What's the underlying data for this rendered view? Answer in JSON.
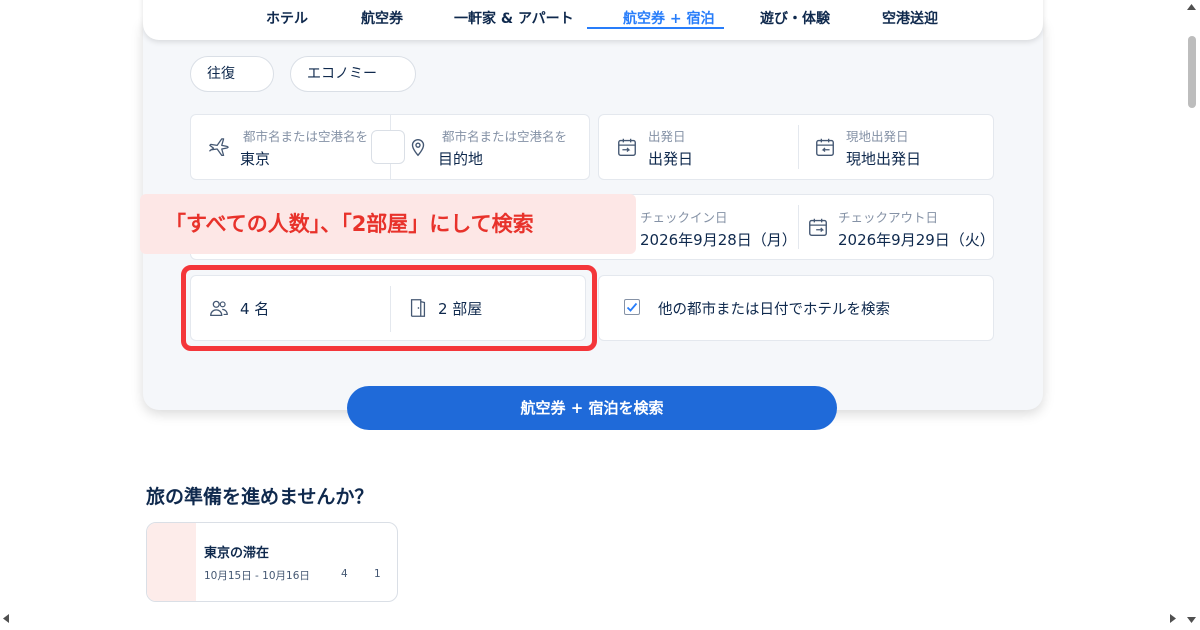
{
  "tabs": [
    {
      "label": "ホテル"
    },
    {
      "label": "航空券"
    },
    {
      "label": "一軒家 & アパート"
    },
    {
      "label": "航空券 + 宿泊",
      "active": true
    },
    {
      "label": "遊び・体験"
    },
    {
      "label": "空港送迎"
    }
  ],
  "trip_type": "往復",
  "cabin_class": "エコノミー",
  "origin": {
    "label": "都市名または空港名を",
    "value": "東京",
    "icon": "airplane-icon"
  },
  "destination": {
    "label": "都市名または空港名を",
    "value": "目的地",
    "icon": "location-pin-icon"
  },
  "depart": {
    "label": "出発日",
    "value": "出発日",
    "icon": "calendar-depart-icon"
  },
  "local_depart": {
    "label": "現地出発日",
    "value": "現地出発日",
    "icon": "calendar-return-icon"
  },
  "checkin": {
    "label": "チェックイン日",
    "value": "2026年9月28日（月）"
  },
  "checkout": {
    "label": "チェックアウト日",
    "value": "2026年9月29日（火）"
  },
  "guests": {
    "value": "4 名",
    "icon": "people-icon"
  },
  "rooms": {
    "value": "2 部屋",
    "icon": "door-icon"
  },
  "other_city": {
    "label": "他の都市または日付でホテルを検索",
    "checked": true
  },
  "annotation": "「すべての人数」、「2部屋」にして検索",
  "search_button": "航空券 + 宿泊を検索",
  "section_title": "旅の準備を進めませんか？",
  "recent_card": {
    "title": "東京の滞在",
    "dates": "10月15日 - 10月16日",
    "guests": "4",
    "rooms": "1"
  },
  "colors": {
    "accent": "#287dfa",
    "button": "#1f6ad9",
    "annotation_text": "#e8322b",
    "annotation_bg": "#fde7e6",
    "highlight_border": "#f4363a"
  }
}
